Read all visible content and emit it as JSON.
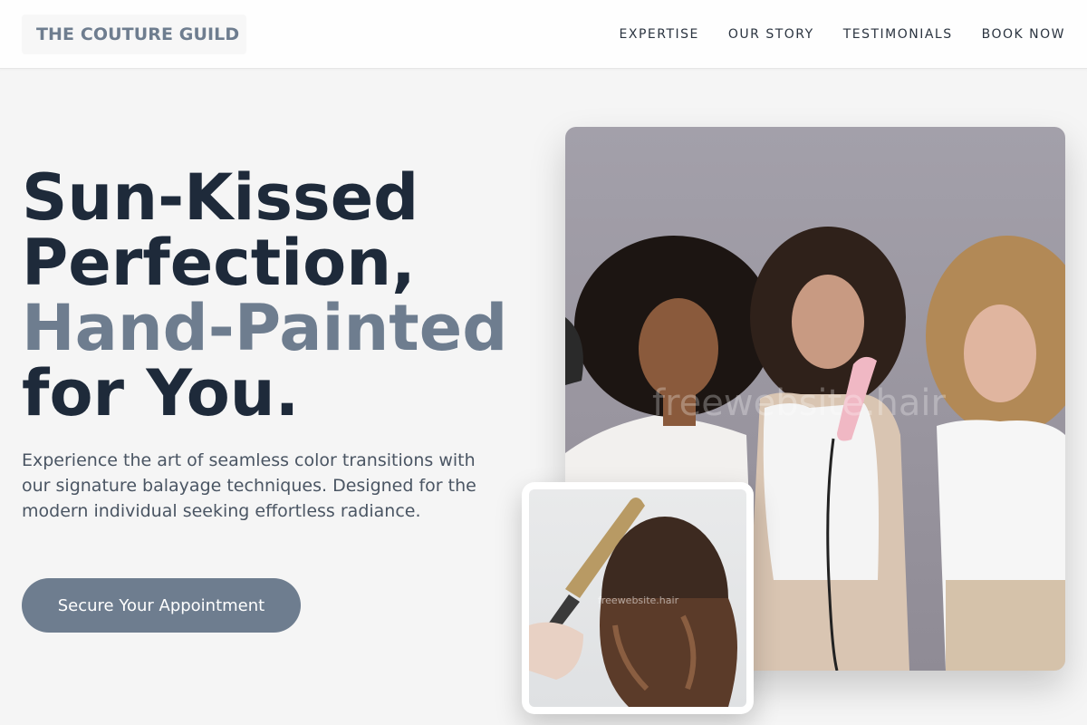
{
  "brand": {
    "name": "THE COUTURE GUILD"
  },
  "nav": {
    "items": [
      {
        "label": "EXPERTISE"
      },
      {
        "label": "OUR STORY"
      },
      {
        "label": "TESTIMONIALS"
      },
      {
        "label": "BOOK NOW"
      }
    ]
  },
  "hero": {
    "headline": {
      "line1": "Sun-Kissed",
      "line2": "Perfection,",
      "accent": "Hand-Painted",
      "line4": "for You."
    },
    "lead": "Experience the art of seamless color transitions with our signature balayage techniques. Designed for the modern individual seeking effortless radiance.",
    "cta_label": "Secure Your Appointment"
  },
  "images": {
    "main_watermark": "freewebsite.hair",
    "detail_watermark": "freewebsite.hair"
  },
  "colors": {
    "accent": "#6e7d8f",
    "text_dark": "#1e2a3a",
    "background": "#f5f5f5"
  }
}
